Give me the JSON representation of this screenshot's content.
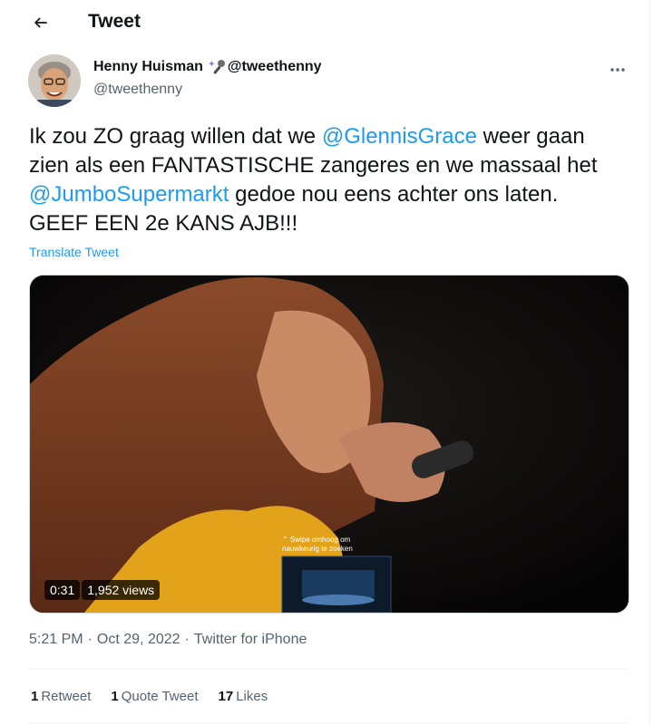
{
  "header": {
    "title": "Tweet",
    "back_icon": "arrow-left-icon"
  },
  "author": {
    "display_name": "Henny Huisman",
    "emoji": "microphone-sparkle-icon",
    "name_suffix": "@tweethenny",
    "handle": "@tweethenny"
  },
  "more_icon": "more-horizontal-icon",
  "tweet": {
    "segments": [
      {
        "text": "Ik zou ZO graag willen dat we ",
        "type": "text"
      },
      {
        "text": "@GlennisGrace",
        "type": "mention"
      },
      {
        "text": " weer gaan zien als een FANTASTISCHE zangeres en we massaal het ",
        "type": "text"
      },
      {
        "text": "@JumboSupermarkt",
        "type": "mention"
      },
      {
        "text": " gedoe nou eens achter ons laten. GEEF EEN 2e KANS AJB!!!",
        "type": "text"
      }
    ],
    "translate_label": "Translate Tweet"
  },
  "video": {
    "duration": "0:31",
    "views": "1,952 views",
    "overlay_text_1": "⌃ Swipe omhoog om",
    "overlay_text_2": "nauwkeurig te zoeken"
  },
  "meta": {
    "time": "5:21 PM",
    "date": "Oct 29, 2022",
    "source": "Twitter for iPhone"
  },
  "stats": {
    "retweets_count": "1",
    "retweets_label": "Retweet",
    "quotes_count": "1",
    "quotes_label": "Quote Tweet",
    "likes_count": "17",
    "likes_label": "Likes"
  },
  "colors": {
    "accent": "#1d9bf0",
    "secondary_text": "#536471",
    "primary_text": "#0f1419",
    "border": "#eff3f4"
  }
}
